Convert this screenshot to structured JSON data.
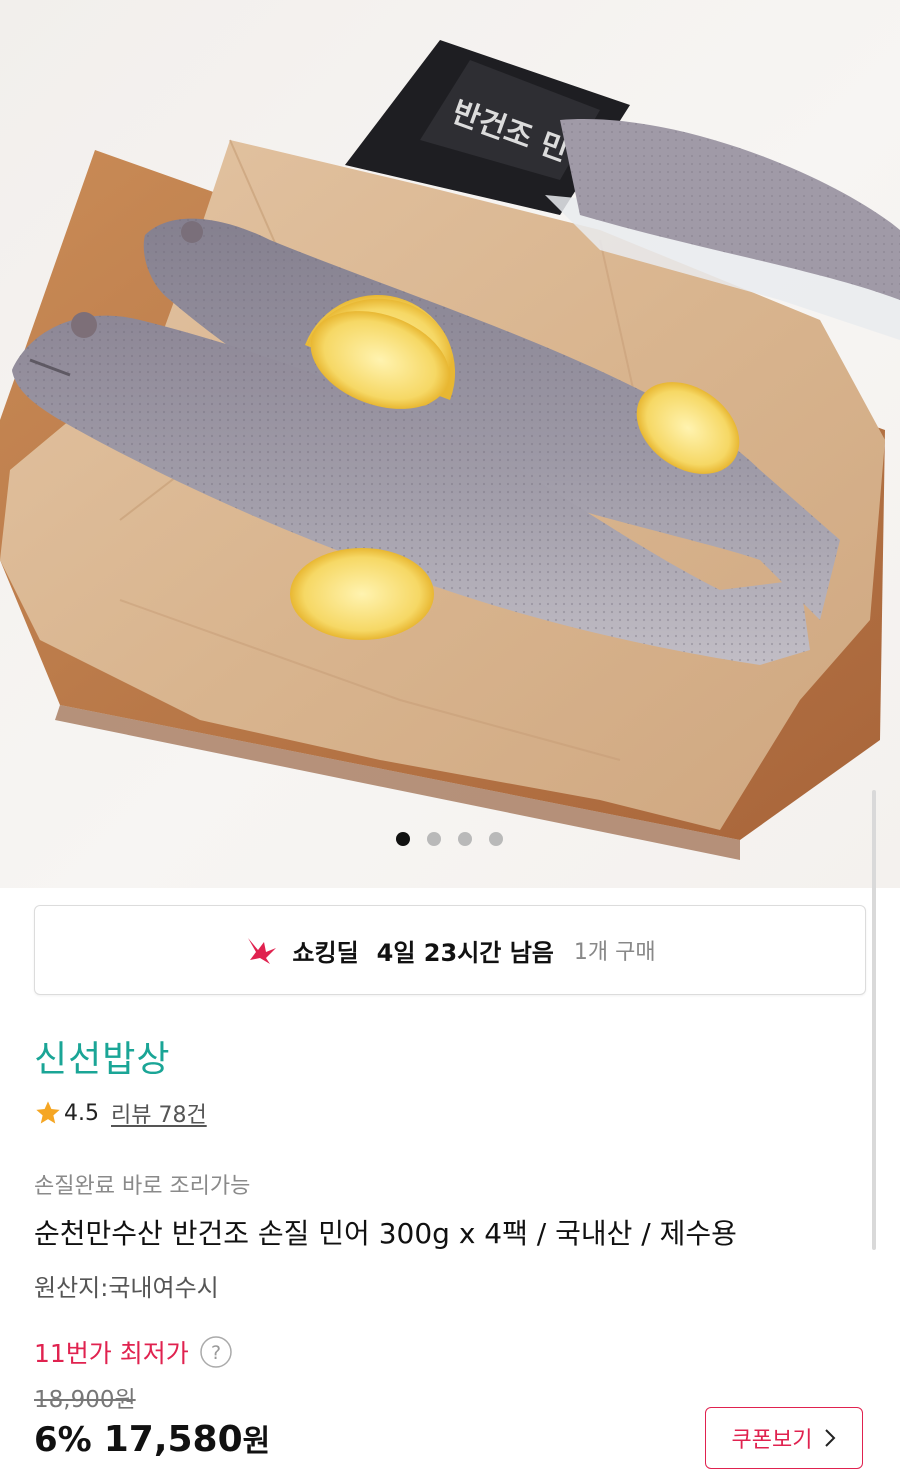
{
  "gallery": {
    "image_alt": "반건조 민어",
    "package_text": "반건조 민어",
    "slides_total": 4,
    "slide_active": 1
  },
  "deal": {
    "title": "쇼킹딜",
    "time_left": "4일 23시간 남음",
    "purchase_count": "1개 구매",
    "accent_color": "#e0224f"
  },
  "store": {
    "name": "신선밥상",
    "color": "#1aa596"
  },
  "rating": {
    "score": "4.5",
    "reviews_label": "리뷰 78건",
    "star_icon": "star-icon",
    "star_color": "#f5a623"
  },
  "product": {
    "subtitle": "손질완료 바로 조리가능",
    "name": "순천만수산 반건조 손질 민어 300g x 4팩 / 국내산 / 제수용",
    "origin": "원산지:국내여수시"
  },
  "price": {
    "lowest_label": "11번가 최저가",
    "original": "18,900원",
    "discount": "6%",
    "final": "17,580",
    "currency": "원",
    "coupon_label": "쿠폰보기"
  }
}
